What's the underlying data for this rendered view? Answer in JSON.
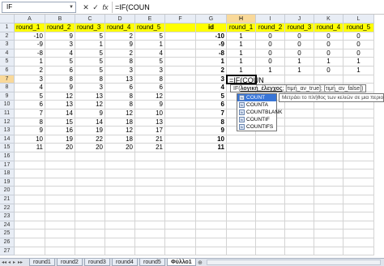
{
  "formula_bar": {
    "name_box": "IF",
    "cancel_glyph": "✕",
    "enter_glyph": "✓",
    "fx_label": "fx",
    "formula": "=IF(COUN"
  },
  "columns": [
    "A",
    "B",
    "C",
    "D",
    "E",
    "F",
    "G",
    "H",
    "I",
    "J",
    "K",
    "L"
  ],
  "rows": [
    "1",
    "2",
    "3",
    "4",
    "5",
    "6",
    "7",
    "8",
    "9",
    "10",
    "11",
    "12",
    "13",
    "14",
    "15",
    "16",
    "17",
    "18",
    "19",
    "20",
    "21",
    "22",
    "23",
    "24",
    "25",
    "26",
    "27"
  ],
  "left_table": {
    "headers": [
      "round_1",
      "round_2",
      "round_3",
      "round_4",
      "round_5"
    ],
    "data": [
      [
        "-10",
        "9",
        "5",
        "2",
        "5"
      ],
      [
        "-9",
        "3",
        "1",
        "9",
        "1"
      ],
      [
        "-8",
        "4",
        "5",
        "2",
        "4"
      ],
      [
        "1",
        "5",
        "5",
        "8",
        "5"
      ],
      [
        "2",
        "6",
        "5",
        "3",
        "3"
      ],
      [
        "3",
        "8",
        "8",
        "13",
        "8"
      ],
      [
        "4",
        "9",
        "3",
        "6",
        "6"
      ],
      [
        "5",
        "12",
        "13",
        "8",
        "12"
      ],
      [
        "6",
        "13",
        "12",
        "8",
        "9"
      ],
      [
        "7",
        "14",
        "9",
        "12",
        "10"
      ],
      [
        "8",
        "15",
        "14",
        "18",
        "13"
      ],
      [
        "9",
        "16",
        "19",
        "12",
        "17"
      ],
      [
        "10",
        "19",
        "22",
        "18",
        "21"
      ],
      [
        "11",
        "20",
        "20",
        "20",
        "21"
      ]
    ]
  },
  "right_table": {
    "id_header": "id",
    "headers": [
      "round_1",
      "round_2",
      "round_3",
      "round_4",
      "round_5"
    ],
    "ids": [
      "-10",
      "-9",
      "-8",
      "1",
      "2",
      "3",
      "4",
      "5",
      "6",
      "7",
      "8",
      "9",
      "10",
      "11"
    ],
    "data": [
      [
        "1",
        "0",
        "0",
        "0",
        "0"
      ],
      [
        "1",
        "0",
        "0",
        "0",
        "0"
      ],
      [
        "1",
        "0",
        "0",
        "0",
        "0"
      ],
      [
        "1",
        "0",
        "1",
        "1",
        "1"
      ],
      [
        "1",
        "1",
        "1",
        "0",
        "1"
      ]
    ]
  },
  "active_cell": {
    "value": "=IF(COUN"
  },
  "tooltip": {
    "prefix": "IF(",
    "arg1": "λογική_έλεγχος",
    "rest": "; [τιμή_αν_true]; [τιμή_αν_false])"
  },
  "autocomplete": {
    "items": [
      "COUNT",
      "COUNTA",
      "COUNTBLANK",
      "COUNTIF",
      "COUNTIFS"
    ],
    "selected_index": 0,
    "icon_label": "fx",
    "description": "Μετράει το πλήθος των κελιών σε μια περιοχή"
  },
  "sheet_tabs": {
    "nav_glyphs": [
      "◂◂",
      "◂",
      "▸",
      "▸▸"
    ],
    "tabs": [
      "round1",
      "round2",
      "round3",
      "round4",
      "round5",
      "Φύλλο1"
    ],
    "active_index": 5,
    "new_tab_glyph": "⊕"
  },
  "colors": {
    "header_yellow": "#ffff00",
    "selected_header": "#f9d99a",
    "autocomplete_selection": "#3875d7"
  }
}
